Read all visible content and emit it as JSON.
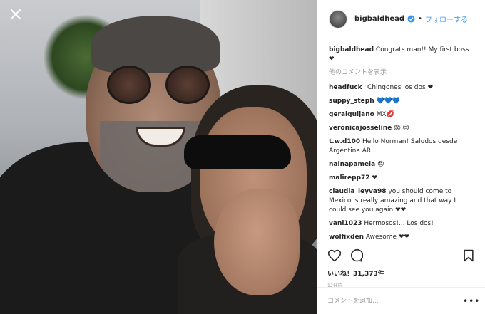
{
  "post": {
    "author": "bigbaldhead",
    "follow_label": "フォローする",
    "separator": "•",
    "caption_author": "bigbaldhead",
    "caption_text": "Congrats man!! My first boss ❤",
    "view_more": "他のコメントを表示",
    "likes": "いいね！31,373件",
    "time": "12分前",
    "comment_placeholder": "コメントを追加...",
    "more_options": "•••"
  },
  "comments": [
    {
      "user": "headfuck_",
      "text": "Chingones los dos ❤"
    },
    {
      "user": "suppy_steph",
      "text": "💙💙💙"
    },
    {
      "user": "geralquijano",
      "text": "MX💋"
    },
    {
      "user": "veronicajosseline",
      "text": "😱 😔"
    },
    {
      "user": "t.w.d100",
      "text": "Hello Norman! Saludos desde Argentina AR"
    },
    {
      "user": "nainapamela",
      "text": "😍"
    },
    {
      "user": "malirepp72",
      "text": "❤"
    },
    {
      "user": "claudia_leyva98",
      "text": "you should come to Mexico is really amazing and that way I could see you again ❤❤"
    },
    {
      "user": "vani1023",
      "text": "Hermosos!... Los dos!"
    },
    {
      "user": "wolfixden",
      "text": "Awesome ❤❤"
    }
  ],
  "icons": {
    "close": "close-icon",
    "verified": "verified-badge-icon",
    "like": "heart-icon",
    "comment": "comment-bubble-icon",
    "save": "bookmark-icon"
  },
  "colors": {
    "link_blue": "#3897f0",
    "text": "#262626",
    "muted": "#999999",
    "divider": "#efefef"
  }
}
